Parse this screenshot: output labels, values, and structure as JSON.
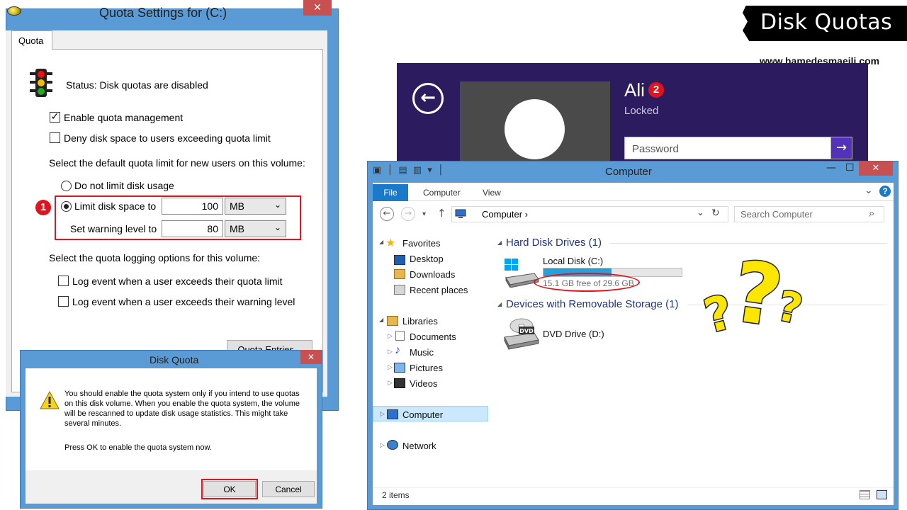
{
  "banner": {
    "title": "Disk Quotas",
    "url": "www.hamedesmaeili.com"
  },
  "quota_settings": {
    "title": "Quota Settings for  (C:)",
    "close": "✕",
    "tab": "Quota",
    "status": "Status:  Disk quotas are disabled",
    "enable_quota": {
      "label": "Enable quota management",
      "checked": true
    },
    "deny_space": {
      "label": "Deny disk space to users exceeding quota limit",
      "checked": false
    },
    "default_limit_heading": "Select the default quota limit for new users on this volume:",
    "no_limit": "Do not limit disk usage",
    "limit_space": {
      "label": "Limit disk space to",
      "value": "100",
      "unit": "MB"
    },
    "warning_level": {
      "label": "Set warning level to",
      "value": "80",
      "unit": "MB"
    },
    "logging_heading": "Select the quota logging options for this volume:",
    "log_limit": "Log event when a user exceeds their quota limit",
    "log_warning": "Log event when a user exceeds their warning level",
    "quota_entries": "Quota Entries...",
    "badge": "1"
  },
  "disk_quota_dialog": {
    "title": "Disk Quota",
    "close": "✕",
    "message": "You should enable the quota system only if you intend to use quotas on this disk volume.  When you enable the quota system, the volume will be rescanned to update disk usage statistics. This might take several minutes.",
    "prompt": "Press OK to enable the quota system now.",
    "ok": "OK",
    "cancel": "Cancel"
  },
  "lock_screen": {
    "user": "Ali",
    "badge": "2",
    "status": "Locked",
    "password_placeholder": "Password",
    "back": "←",
    "submit": "→"
  },
  "explorer": {
    "title": "Computer",
    "quick_access": "▣ │ ▤ ▥ ▾ │",
    "minimize": "—",
    "maximize": "☐",
    "close": "✕",
    "ribbon_tabs": [
      "File",
      "Computer",
      "View"
    ],
    "ribbon_collapse": "⌄",
    "help": "?",
    "nav_back": "←",
    "nav_forward": "→",
    "nav_recent": "▾",
    "nav_up": "↑",
    "address": "Computer ›",
    "address_dropdown": "⌄",
    "refresh": "↻",
    "search_placeholder": "Search Computer",
    "search_icon": "⌕",
    "sidebar": {
      "favorites": "Favorites",
      "desktop": "Desktop",
      "downloads": "Downloads",
      "recent": "Recent places",
      "libraries": "Libraries",
      "documents": "Documents",
      "music": "Music",
      "pictures": "Pictures",
      "videos": "Videos",
      "computer": "Computer",
      "network": "Network"
    },
    "groups": {
      "hdd": "Hard Disk Drives (1)",
      "removable": "Devices with Removable Storage (1)"
    },
    "local_disk": {
      "name": "Local Disk (C:)",
      "free": "15.1 GB free of 29.6 GB",
      "used_fraction": 0.49
    },
    "dvd": {
      "name": "DVD Drive (D:)",
      "label": "DVD"
    },
    "status_items": "2 items"
  },
  "colors": {
    "accent_red": "#e0141e",
    "window_blue": "#5b9bd5",
    "lock_bg": "#2c1b5e",
    "question_yellow": "#ffe600"
  }
}
